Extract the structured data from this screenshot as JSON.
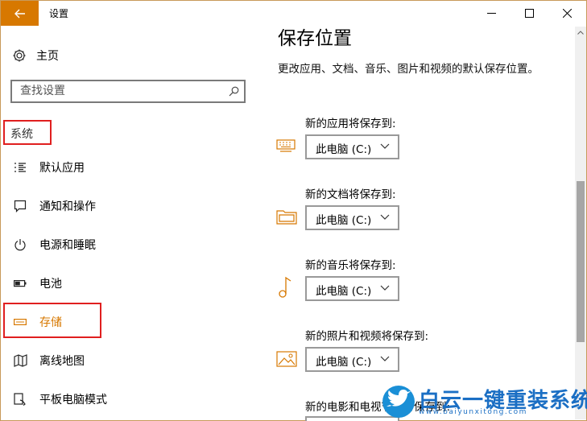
{
  "window": {
    "title": "设置",
    "back_icon": "back-arrow-icon",
    "accent": "#d77800"
  },
  "sidebar": {
    "home_label": "主页",
    "search_placeholder": "查找设置",
    "section": "系统",
    "items": [
      {
        "label": "默认应用",
        "icon": "default-apps-icon"
      },
      {
        "label": "通知和操作",
        "icon": "notification-icon"
      },
      {
        "label": "电源和睡眠",
        "icon": "power-icon"
      },
      {
        "label": "电池",
        "icon": "battery-icon"
      },
      {
        "label": "存储",
        "icon": "storage-icon"
      },
      {
        "label": "离线地图",
        "icon": "map-icon"
      },
      {
        "label": "平板电脑模式",
        "icon": "tablet-icon"
      }
    ]
  },
  "main": {
    "title": "保存位置",
    "description": "更改应用、文档、音乐、图片和视频的默认保存位置。",
    "locations": [
      {
        "label": "新的应用将保存到:",
        "value": "此电脑 (C:)",
        "icon": "keyboard-icon"
      },
      {
        "label": "新的文档将保存到:",
        "value": "此电脑 (C:)",
        "icon": "folder-icon"
      },
      {
        "label": "新的音乐将保存到:",
        "value": "此电脑 (C:)",
        "icon": "music-note-icon"
      },
      {
        "label": "新的照片和视频将保存到:",
        "value": "此电脑 (C:)",
        "icon": "picture-icon"
      },
      {
        "label": "新的电影和电视节目将保存到:",
        "icon": "movie-icon"
      }
    ]
  },
  "watermark": {
    "text": "白云一键重装系统",
    "url": "www.baiyunxitong.com"
  }
}
